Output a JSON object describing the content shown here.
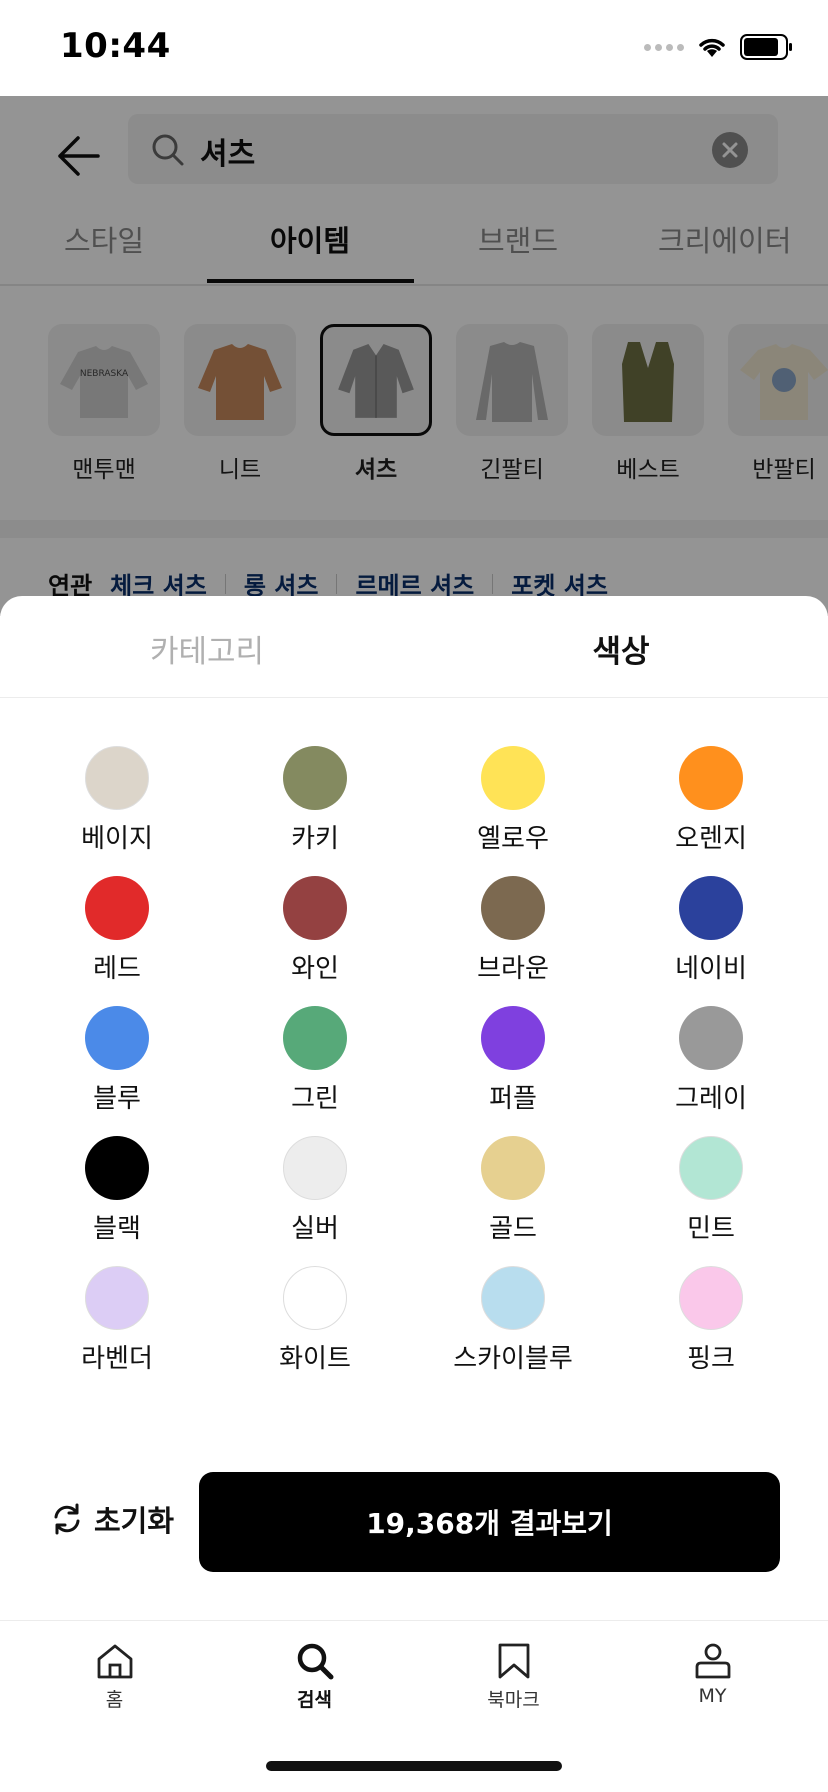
{
  "status_bar": {
    "time": "10:44"
  },
  "search": {
    "query": "셔츠"
  },
  "tabs": [
    {
      "label": "스타일"
    },
    {
      "label": "아이템"
    },
    {
      "label": "브랜드"
    },
    {
      "label": "크리에이터"
    }
  ],
  "categories": [
    {
      "label": "맨투맨"
    },
    {
      "label": "니트"
    },
    {
      "label": "셔츠"
    },
    {
      "label": "긴팔티"
    },
    {
      "label": "베스트"
    },
    {
      "label": "반팔티"
    }
  ],
  "related": {
    "title": "연관",
    "items": [
      "체크 셔츠",
      "롱 셔츠",
      "르메르 셔츠",
      "포켓 셔츠"
    ]
  },
  "sheet": {
    "tab_category": "카테고리",
    "tab_color": "색상",
    "colors": [
      {
        "name": "베이지",
        "hex": "#DCD5CA"
      },
      {
        "name": "카키",
        "hex": "#848A60"
      },
      {
        "name": "옐로우",
        "hex": "#FFE356"
      },
      {
        "name": "오렌지",
        "hex": "#FF901D"
      },
      {
        "name": "레드",
        "hex": "#E12A2A"
      },
      {
        "name": "와인",
        "hex": "#944141"
      },
      {
        "name": "브라운",
        "hex": "#7C6950"
      },
      {
        "name": "네이비",
        "hex": "#2B419C"
      },
      {
        "name": "블루",
        "hex": "#4B8AE8"
      },
      {
        "name": "그린",
        "hex": "#57A979"
      },
      {
        "name": "퍼플",
        "hex": "#7F40DF"
      },
      {
        "name": "그레이",
        "hex": "#999999"
      },
      {
        "name": "블랙",
        "hex": "#000000"
      },
      {
        "name": "실버",
        "hex": "#EDEDED"
      },
      {
        "name": "골드",
        "hex": "#E6D090"
      },
      {
        "name": "민트",
        "hex": "#B2E6D4"
      },
      {
        "name": "라벤더",
        "hex": "#DCCDF5"
      },
      {
        "name": "화이트",
        "hex": "#FFFFFF"
      },
      {
        "name": "스카이블루",
        "hex": "#B8DDEE"
      },
      {
        "name": "핑크",
        "hex": "#FAC8EA"
      }
    ],
    "reset_label": "초기화",
    "results_label": "19,368개 결과보기"
  },
  "bottom_nav": [
    {
      "label": "홈",
      "icon": "home-icon"
    },
    {
      "label": "검색",
      "icon": "search-icon"
    },
    {
      "label": "북마크",
      "icon": "bookmark-icon"
    },
    {
      "label": "MY",
      "icon": "user-icon"
    }
  ]
}
